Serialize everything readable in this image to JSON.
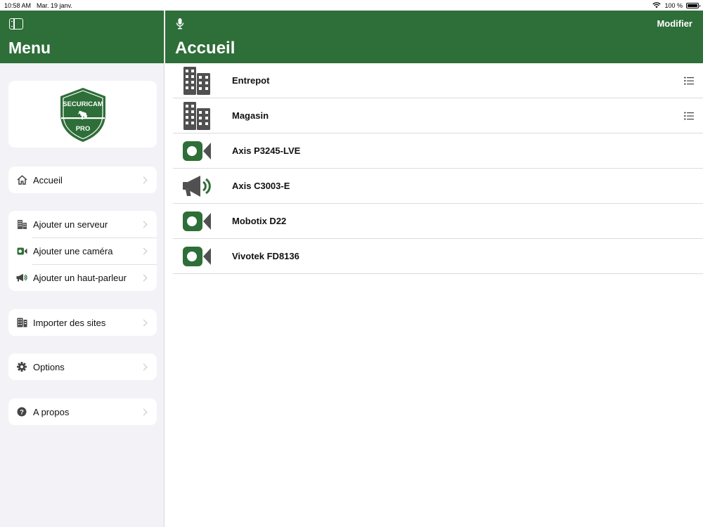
{
  "status_bar": {
    "time": "10:58 AM",
    "date": "Mar. 19 janv.",
    "battery": "100 %"
  },
  "sidebar": {
    "title": "Menu",
    "logo": {
      "top_text": "SECURICAM",
      "bottom_text": "PRO"
    },
    "groups": [
      {
        "items": [
          {
            "label": "Accueil",
            "icon": "home-icon"
          }
        ]
      },
      {
        "items": [
          {
            "label": "Ajouter un serveur",
            "icon": "building-icon"
          },
          {
            "label": "Ajouter une caméra",
            "icon": "camera-icon"
          },
          {
            "label": "Ajouter un haut-parleur",
            "icon": "megaphone-icon"
          }
        ]
      },
      {
        "items": [
          {
            "label": "Importer des sites",
            "icon": "import-sites-icon"
          }
        ]
      },
      {
        "items": [
          {
            "label": "Options",
            "icon": "gear-icon"
          }
        ]
      },
      {
        "items": [
          {
            "label": "A propos",
            "icon": "question-icon"
          }
        ]
      }
    ]
  },
  "main": {
    "title": "Accueil",
    "edit_label": "Modifier",
    "items": [
      {
        "label": "Entrepot",
        "icon": "building-icon",
        "has_list_icon": true
      },
      {
        "label": "Magasin",
        "icon": "building-icon",
        "has_list_icon": true
      },
      {
        "label": "Axis P3245-LVE",
        "icon": "video-camera-icon",
        "has_list_icon": false
      },
      {
        "label": "Axis C3003-E",
        "icon": "megaphone-icon",
        "has_list_icon": false
      },
      {
        "label": "Mobotix D22",
        "icon": "video-camera-icon",
        "has_list_icon": false
      },
      {
        "label": "Vivotek FD8136",
        "icon": "video-camera-icon",
        "has_list_icon": false
      }
    ]
  },
  "colors": {
    "brand_green": "#2e6e38",
    "building_gray": "#505050",
    "sidebar_bg": "#f2f2f7"
  }
}
